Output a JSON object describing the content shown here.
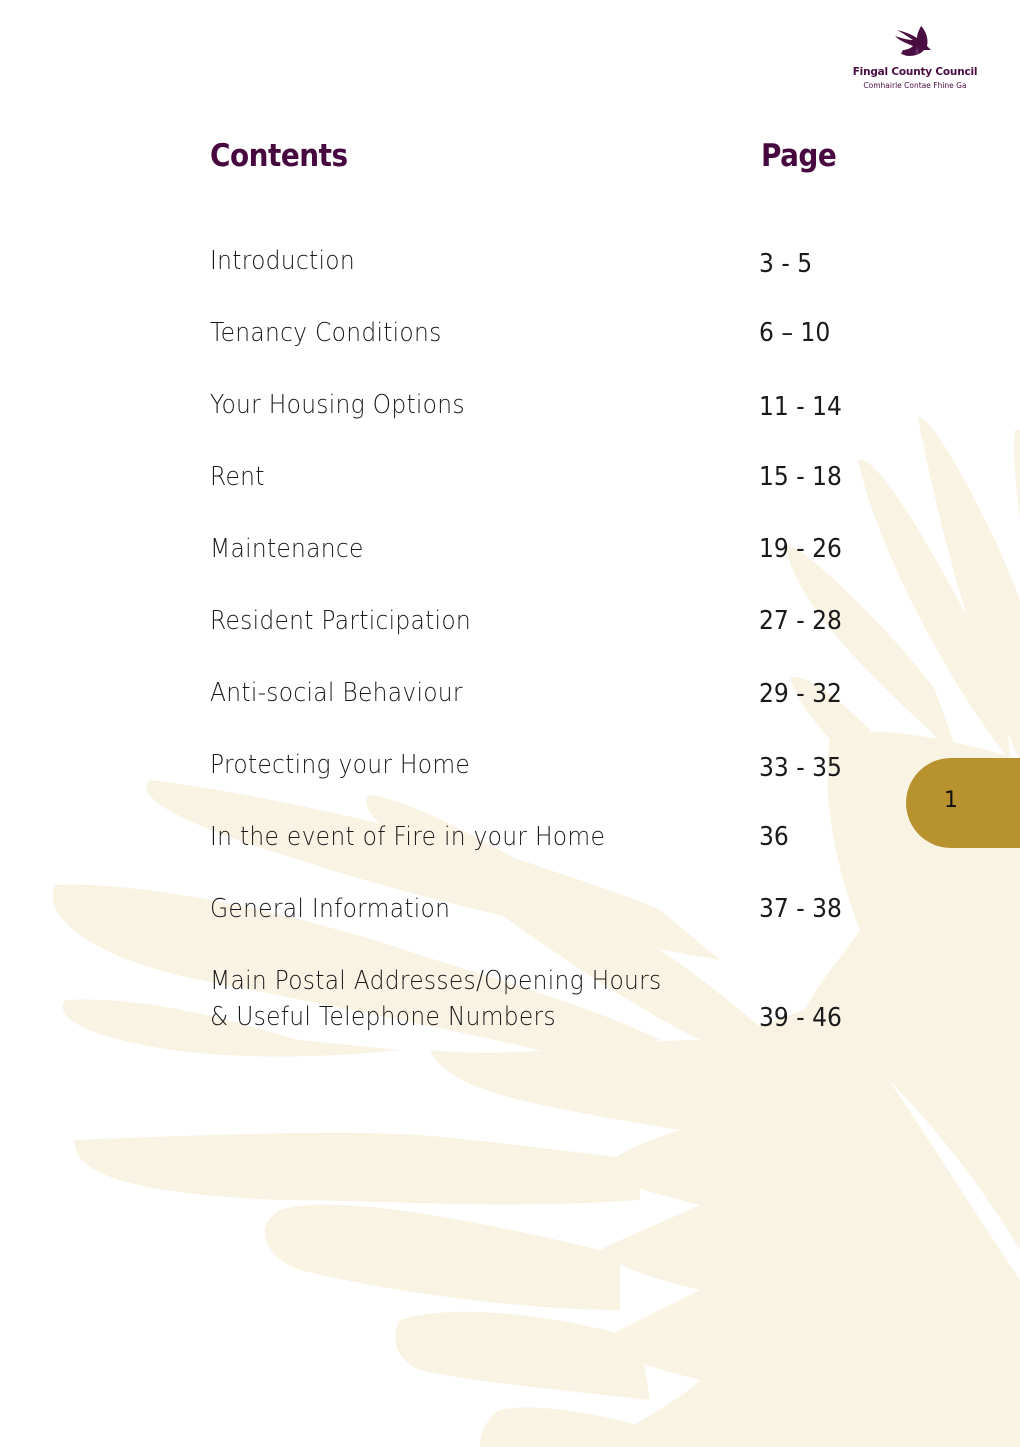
{
  "brand": {
    "name": "Fingal County Council",
    "subtitle": "Comhairle Contae Fhine Ga",
    "logo_icon": "bird-icon",
    "primary_color": "#46083f",
    "accent_color": "#b8922e",
    "wing_color": "#f9f3e3"
  },
  "headings": {
    "contents": "Contents",
    "page": "Page"
  },
  "toc": [
    {
      "title": "Introduction",
      "pages": "3 - 5"
    },
    {
      "title": "Tenancy Conditions",
      "pages": "6 – 10"
    },
    {
      "title": "Your Housing Options",
      "pages": "11 - 14"
    },
    {
      "title": "Rent",
      "pages": "15 - 18"
    },
    {
      "title": "Maintenance",
      "pages": "19 - 26"
    },
    {
      "title": "Resident Participation",
      "pages": "27 - 28"
    },
    {
      "title": "Anti-social Behaviour",
      "pages": "29 - 32"
    },
    {
      "title": "Protecting your Home",
      "pages": "33 - 35"
    },
    {
      "title": "In the event of Fire in your Home",
      "pages": "36"
    },
    {
      "title": "General Information",
      "pages": "37 - 38"
    },
    {
      "title": "Main Postal Addresses/Opening Hours",
      "title_line2": "& Useful Telephone Numbers",
      "pages": "39 - 46"
    }
  ],
  "page_number": "1"
}
